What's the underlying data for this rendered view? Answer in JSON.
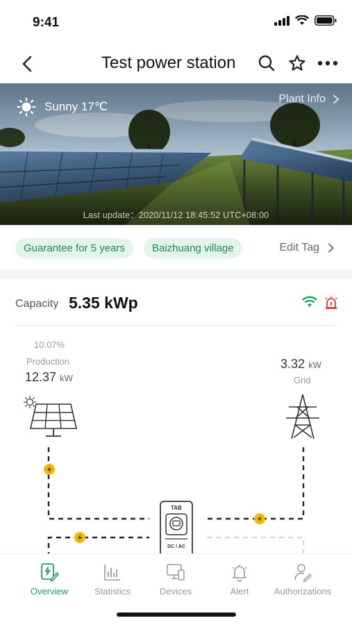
{
  "status_bar": {
    "time": "9:41"
  },
  "nav": {
    "title": "Test power station",
    "icons": [
      "back-arrow-icon",
      "search-icon",
      "star-icon",
      "more-icon"
    ]
  },
  "hero": {
    "weather_icon": "sun-icon",
    "weather_text": "Sunny 17℃",
    "plant_info_label": "Plant Info",
    "last_update": "Last update：2020/11/12 18:45:52 UTC+08:00"
  },
  "tags": {
    "items": [
      "Guarantee for 5 years",
      "Baizhuang village"
    ],
    "edit_label": "Edit Tag"
  },
  "capacity": {
    "label": "Capacity",
    "value": "5.35 kWp",
    "status_icons": [
      "wifi-icon",
      "alarm-icon"
    ],
    "status_colors": {
      "wifi": "#1aa05a",
      "alarm": "#e53935"
    }
  },
  "flow": {
    "production_percent": "10.07%",
    "production_label": "Production",
    "production_value": "12.37",
    "production_unit": "kW",
    "grid_value": "3.32",
    "grid_unit": "kW",
    "grid_label": "Grid",
    "inverter_top_text": "TAB",
    "inverter_bottom_text": "DC / AC",
    "accent_color": "#f5b800"
  },
  "tabs": [
    {
      "label": "Overview",
      "active": true,
      "icon": "overview-icon"
    },
    {
      "label": "Statistics",
      "active": false,
      "icon": "statistics-icon"
    },
    {
      "label": "Devices",
      "active": false,
      "icon": "devices-icon"
    },
    {
      "label": "Alert",
      "active": false,
      "icon": "alert-bell-icon"
    },
    {
      "label": "Authorizations",
      "active": false,
      "icon": "authorizations-icon"
    }
  ],
  "colors": {
    "brand_green": "#1aa05a",
    "tag_bg": "#e4f4ec"
  }
}
